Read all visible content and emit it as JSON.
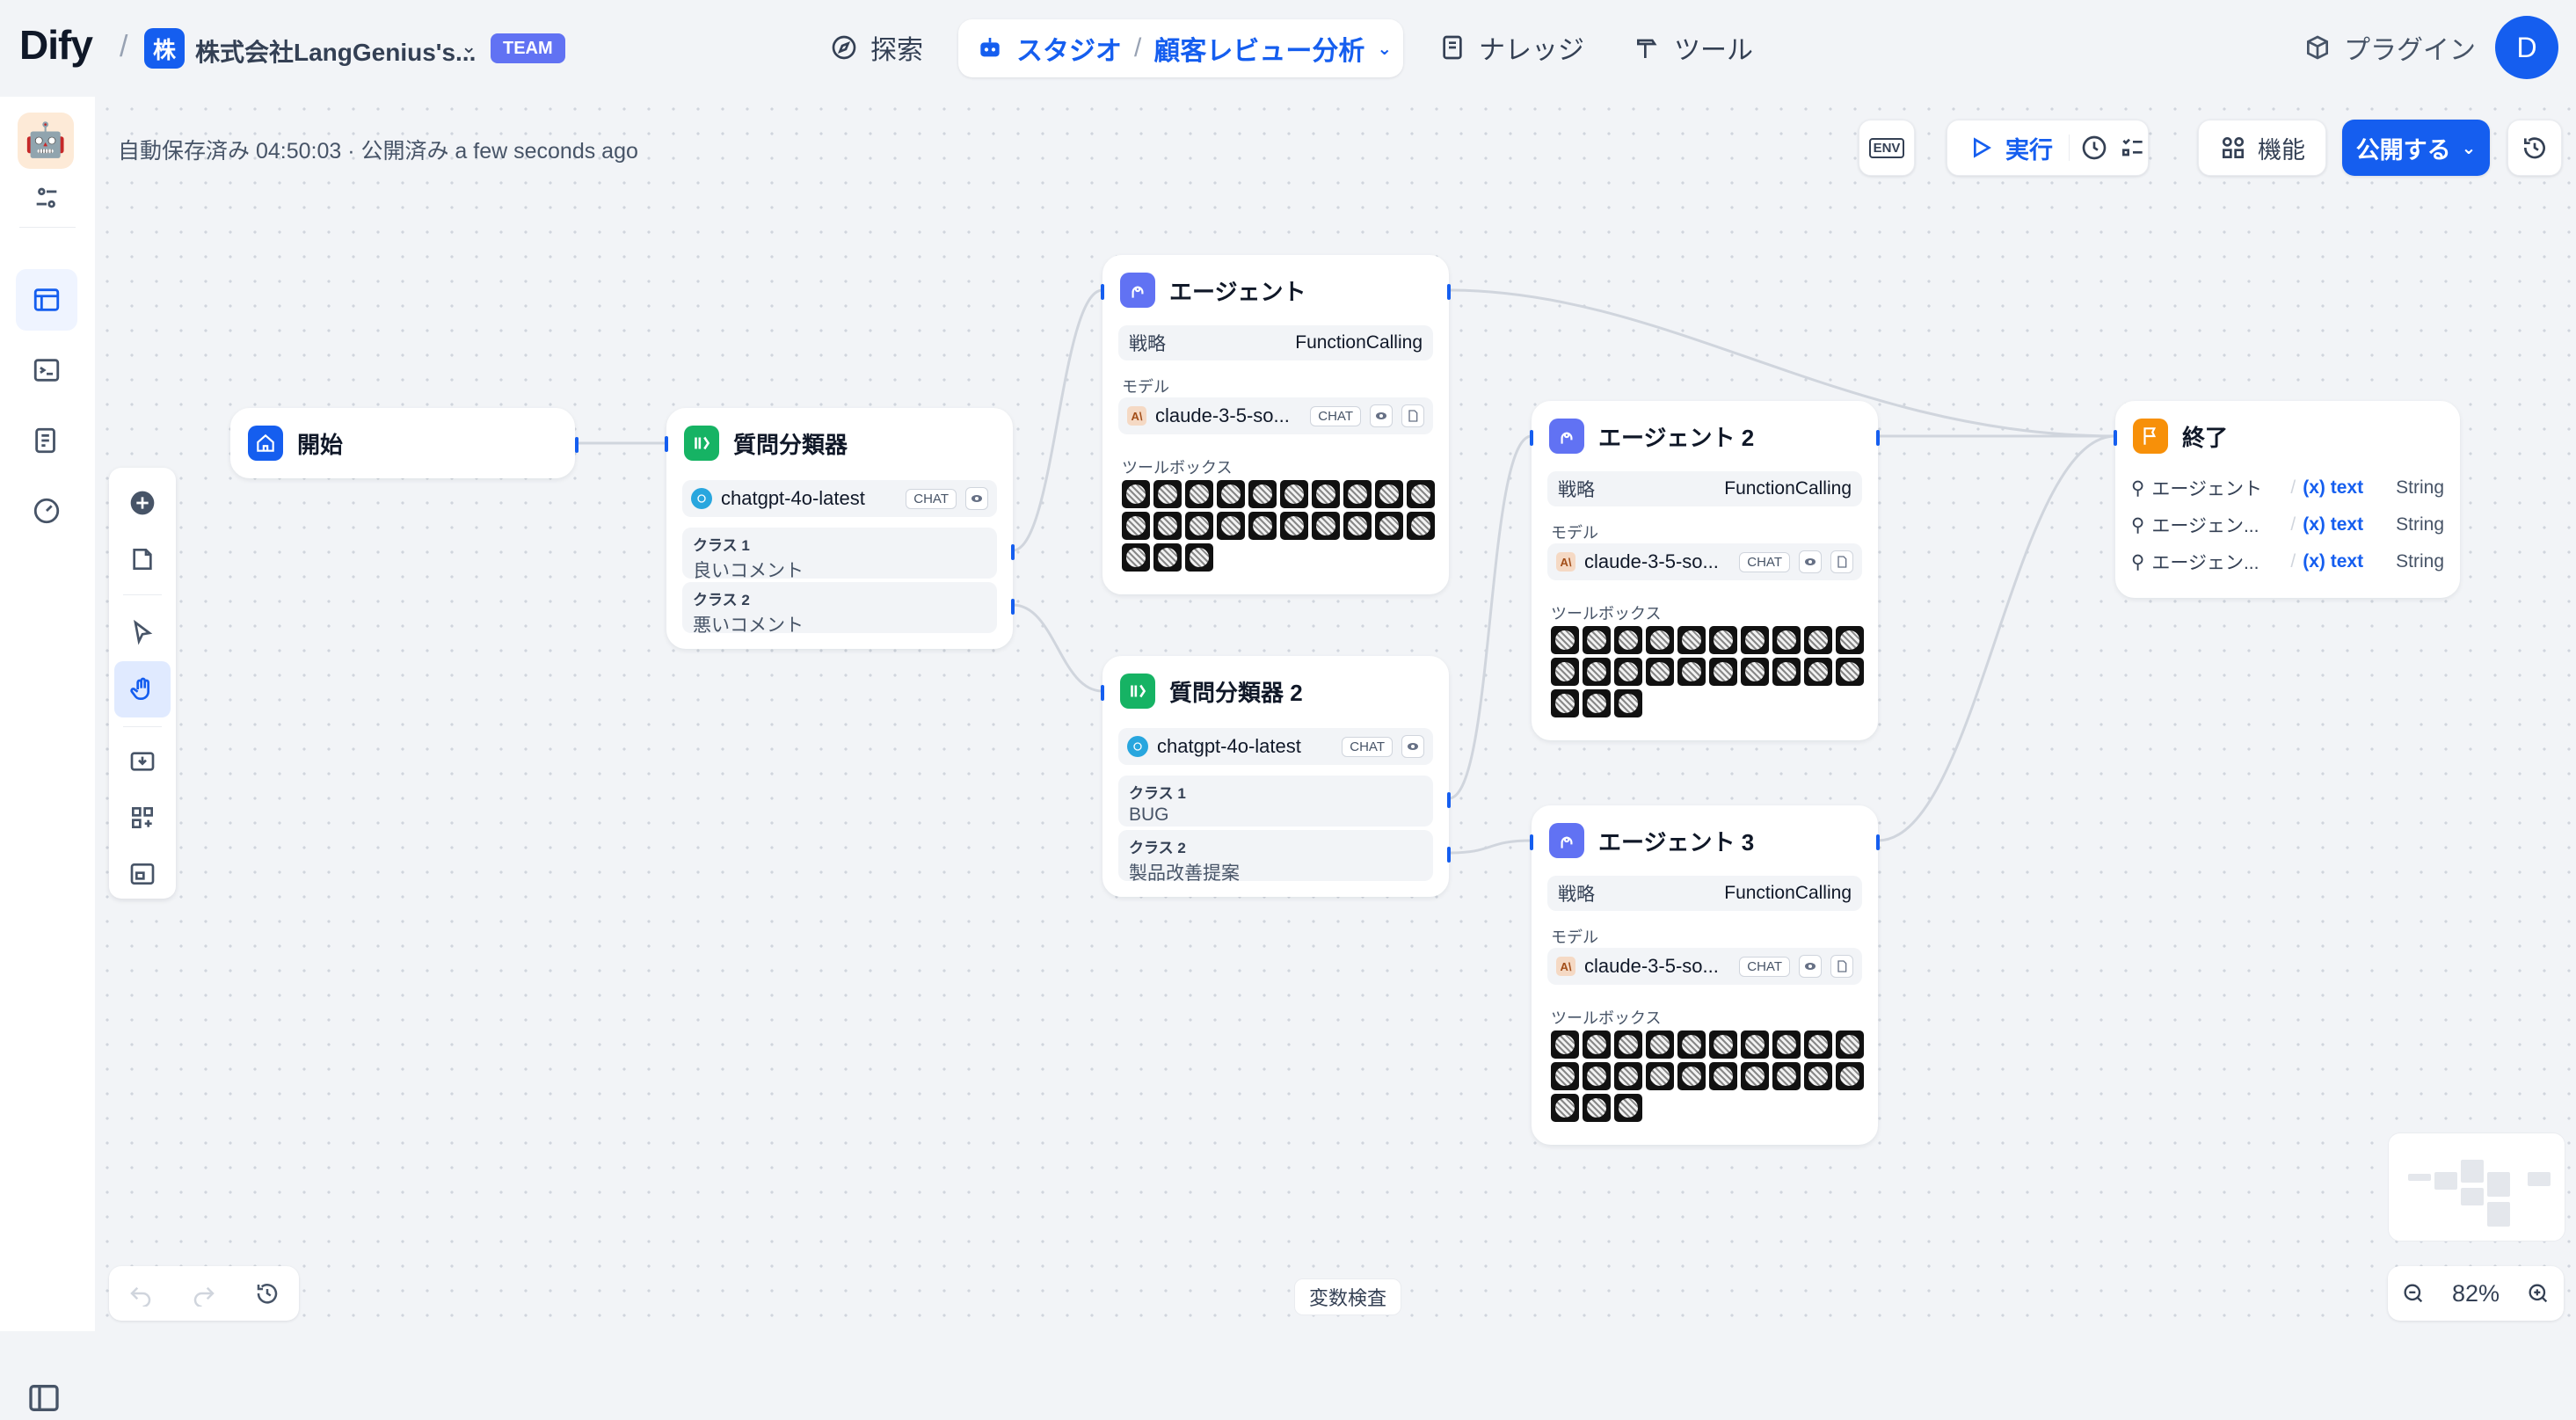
{
  "header": {
    "logo": "Dify",
    "workspace_initial": "株",
    "workspace_name": "株式会社LangGenius's...",
    "team_badge": "TEAM",
    "nav": {
      "explore": "探索",
      "studio": "スタジオ",
      "app_name": "顧客レビュー分析",
      "knowledge": "ナレッジ",
      "tools": "ツール",
      "plugins": "プラグイン"
    },
    "user_initial": "D"
  },
  "toolbar": {
    "autosave": "自動保存済み 04:50:03 · 公開済み a few seconds ago",
    "env": "ENV",
    "run": "実行",
    "features": "機能",
    "publish": "公開する"
  },
  "nodes": {
    "start": {
      "title": "開始"
    },
    "classifier1": {
      "title": "質問分類器",
      "model": "chatgpt-4o-latest",
      "chip": "CHAT",
      "classes": [
        {
          "label": "クラス 1",
          "value": "良いコメント"
        },
        {
          "label": "クラス 2",
          "value": "悪いコメント"
        }
      ]
    },
    "agent1": {
      "title": "エージェント",
      "strategy_label": "戦略",
      "strategy": "FunctionCalling",
      "model_label": "モデル",
      "model": "claude-3-5-so...",
      "chip": "CHAT",
      "toolbox_label": "ツールボックス",
      "tool_count": 23
    },
    "classifier2": {
      "title": "質問分類器 2",
      "model": "chatgpt-4o-latest",
      "chip": "CHAT",
      "classes": [
        {
          "label": "クラス 1",
          "value": "BUG"
        },
        {
          "label": "クラス 2",
          "value": "製品改善提案"
        }
      ]
    },
    "agent2": {
      "title": "エージェント 2",
      "strategy_label": "戦略",
      "strategy": "FunctionCalling",
      "model_label": "モデル",
      "model": "claude-3-5-so...",
      "chip": "CHAT",
      "toolbox_label": "ツールボックス",
      "tool_count": 23
    },
    "agent3": {
      "title": "エージェント 3",
      "strategy_label": "戦略",
      "strategy": "FunctionCalling",
      "model_label": "モデル",
      "model": "claude-3-5-so...",
      "chip": "CHAT",
      "toolbox_label": "ツールボックス",
      "tool_count": 23
    },
    "end": {
      "title": "終了",
      "outputs": [
        {
          "source": "エージェント",
          "ref": "text",
          "type": "String"
        },
        {
          "source": "エージェン...",
          "ref": "text",
          "type": "String"
        },
        {
          "source": "エージェン...",
          "ref": "text",
          "type": "String"
        }
      ]
    }
  },
  "footer": {
    "variable_inspect": "変数検査",
    "zoom": "82%"
  },
  "colors": {
    "accent": "#155eef",
    "classifier": "#16b364",
    "agent": "#6172f3",
    "end": "#f79009"
  }
}
